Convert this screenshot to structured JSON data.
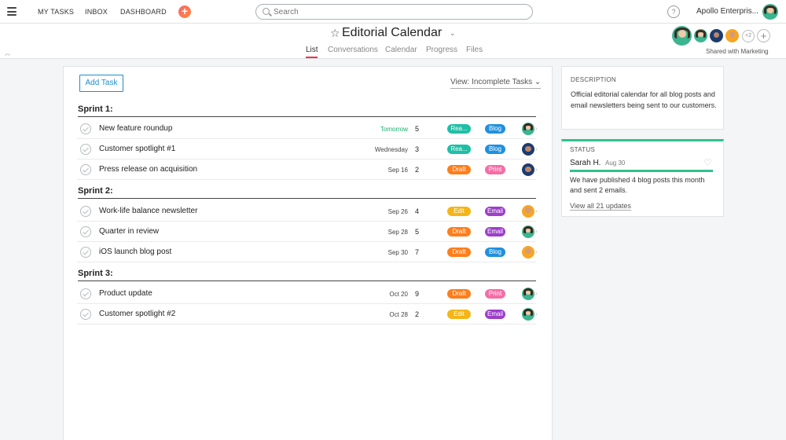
{
  "topbar": {
    "nav": [
      "MY TASKS",
      "INBOX",
      "DASHBOARD"
    ],
    "search_placeholder": "Search",
    "help": "?",
    "org_name": "Apollo Enterpris..."
  },
  "project": {
    "title": "Editorial Calendar",
    "tabs": [
      "List",
      "Conversations",
      "Calendar",
      "Progress",
      "Files"
    ],
    "active_tab": "List",
    "more_members": "+2",
    "shared_with": "Shared with Marketing"
  },
  "tasks": {
    "add_task_label": "Add Task",
    "view_label": "View: Incomplete Tasks ⌄",
    "sections": [
      {
        "title": "Sprint 1:",
        "rows": [
          {
            "name": "New feature roundup",
            "date": "Tomorrow",
            "count": "5",
            "tag1": "Rea...",
            "tag1_color": "#1fbfa6",
            "tag2": "Blog",
            "tag2_color": "#1f90de",
            "avatar": "teal",
            "soon": true
          },
          {
            "name": "Customer spotlight #1",
            "date": "Wednesday",
            "count": "3",
            "tag1": "Rea...",
            "tag1_color": "#1fbfa6",
            "tag2": "Blog",
            "tag2_color": "#1f90de",
            "avatar": "dark",
            "soon": false
          },
          {
            "name": "Press release on acquisition",
            "date": "Sep 16",
            "count": "2",
            "tag1": "Draft",
            "tag1_color": "#fd7e1c",
            "tag2": "Print",
            "tag2_color": "#f46ea6",
            "avatar": "dark",
            "soon": false
          }
        ]
      },
      {
        "title": "Sprint 2:",
        "rows": [
          {
            "name": "Work-life balance newsletter",
            "date": "Sep 26",
            "count": "4",
            "tag1": "Edit",
            "tag1_color": "#f5b517",
            "tag2": "Email",
            "tag2_color": "#9c3fc9",
            "avatar": "orange",
            "soon": false
          },
          {
            "name": "Quarter in review",
            "date": "Sep 28",
            "count": "5",
            "tag1": "Draft",
            "tag1_color": "#fd7e1c",
            "tag2": "Email",
            "tag2_color": "#9c3fc9",
            "avatar": "teal",
            "soon": false
          },
          {
            "name": "iOS launch blog post",
            "date": "Sep 30",
            "count": "7",
            "tag1": "Draft",
            "tag1_color": "#fd7e1c",
            "tag2": "Blog",
            "tag2_color": "#1f90de",
            "avatar": "orange",
            "soon": false
          }
        ]
      },
      {
        "title": "Sprint 3:",
        "rows": [
          {
            "name": "Product update",
            "date": "Oct 20",
            "count": "9",
            "tag1": "Draft",
            "tag1_color": "#fd7e1c",
            "tag2": "Print",
            "tag2_color": "#f46ea6",
            "avatar": "teal",
            "soon": false
          },
          {
            "name": "Customer spotlight #2",
            "date": "Oct 28",
            "count": "2",
            "tag1": "Edit",
            "tag1_color": "#f5b517",
            "tag2": "Email",
            "tag2_color": "#9c3fc9",
            "avatar": "teal",
            "soon": false
          }
        ]
      }
    ]
  },
  "description": {
    "label": "DESCRIPTION",
    "text": "Official editorial calendar for all blog posts and email newsletters being sent to our customers."
  },
  "status": {
    "label": "STATUS",
    "author": "Sarah H.",
    "date": "Aug 30",
    "text": "We have published 4 blog posts this month and sent 2 emails.",
    "link": "View all 21 updates",
    "color": "#31c18c"
  }
}
